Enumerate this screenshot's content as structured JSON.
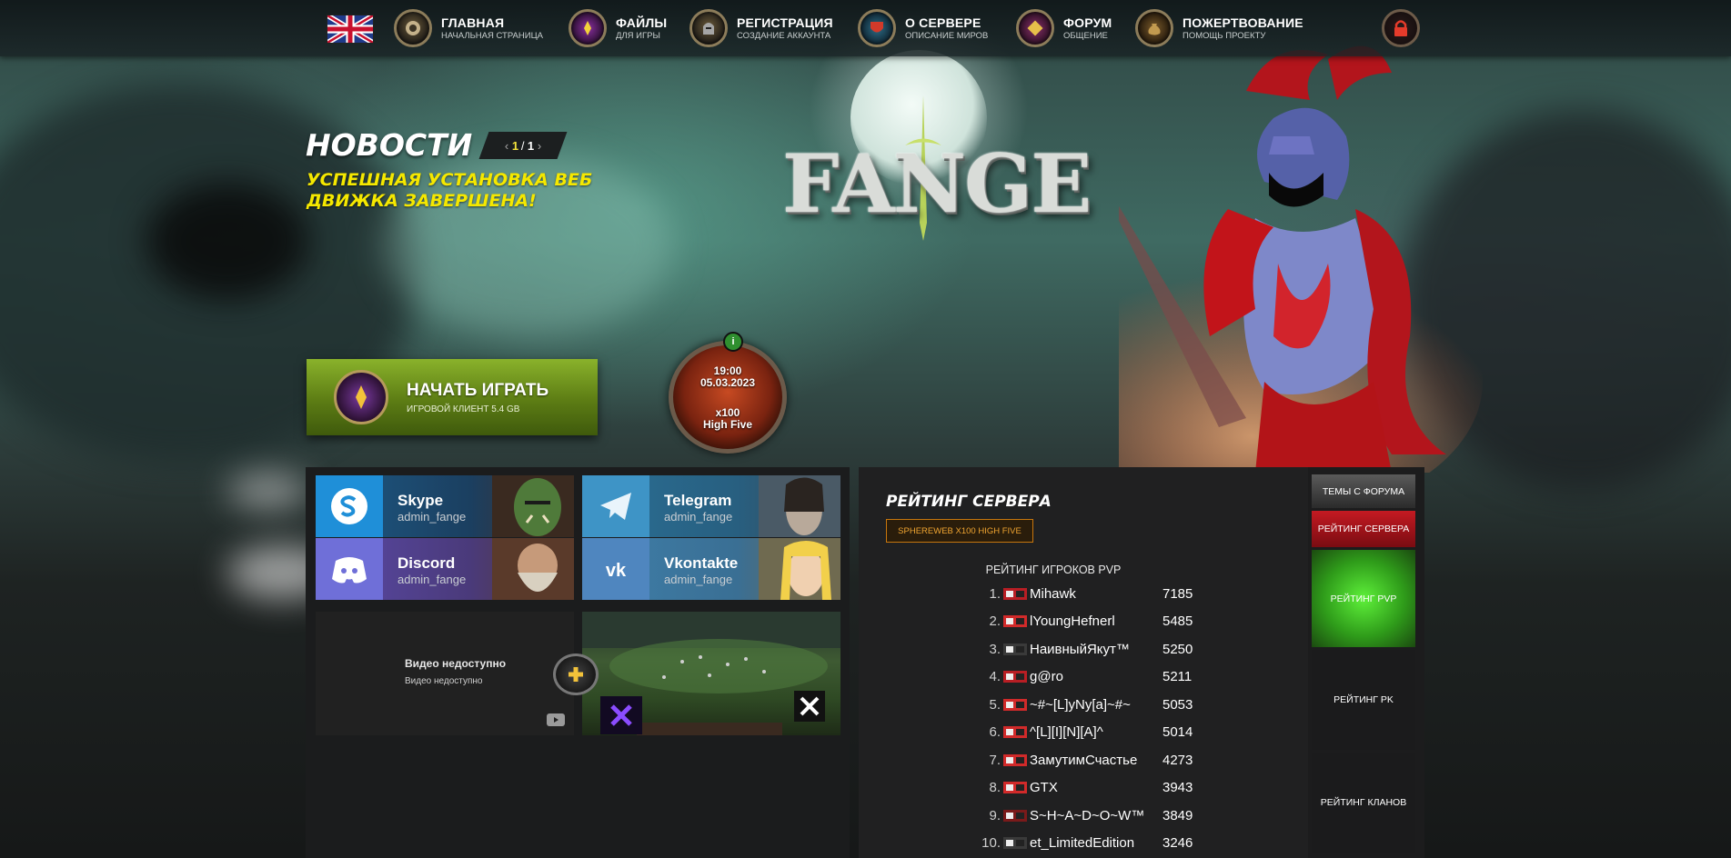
{
  "nav": {
    "items": [
      {
        "title": "ГЛАВНАЯ",
        "sub": "НАЧАЛЬНАЯ СТРАНИЦА"
      },
      {
        "title": "ФАЙЛЫ",
        "sub": "ДЛЯ ИГРЫ"
      },
      {
        "title": "РЕГИСТРАЦИЯ",
        "sub": "СОЗДАНИЕ АККАУНТА"
      },
      {
        "title": "О СЕРВЕРЕ",
        "sub": "ОПИСАНИЕ МИРОВ"
      },
      {
        "title": "ФОРУМ",
        "sub": "ОБЩЕНИЕ"
      },
      {
        "title": "ПОЖЕРТВОВАНИЕ",
        "sub": "ПОМОЩЬ ПРОЕКТУ"
      }
    ]
  },
  "news": {
    "title": "НОВОСТИ",
    "pager": {
      "current": "1",
      "sep": "/",
      "total": "1",
      "prev": "‹",
      "next": "›"
    },
    "headline": "УСПЕШНАЯ УСТАНОВКА ВЕБ ДВИЖКА ЗАВЕРШЕНА!"
  },
  "logo": {
    "text": "FANGE"
  },
  "play": {
    "title": "НАЧАТЬ ИГРАТЬ",
    "sub": "ИГРОВОЙ КЛИЕНТ 5.4 GB"
  },
  "server_badge": {
    "time": "19:00",
    "date": "05.03.2023",
    "rate": "x100",
    "chronicle": "High Five",
    "info": "i"
  },
  "social": [
    {
      "name": "Skype",
      "user": "admin_fange"
    },
    {
      "name": "Telegram",
      "user": "admin_fange"
    },
    {
      "name": "Discord",
      "user": "admin_fange"
    },
    {
      "name": "Vkontakte",
      "user": "admin_fange"
    }
  ],
  "video": {
    "unavailable_title": "Видео недоступно",
    "unavailable_sub": "Видео недоступно"
  },
  "rating": {
    "title": "РЕЙТИНГ СЕРВЕРА",
    "server_button": "SPHEREWEB X100 HIGH FIVE",
    "subtitle": "РЕЙТИНГ ИГРОКОВ PVP",
    "rows": [
      {
        "num": "1.",
        "name": "Mihawk",
        "score": "7185"
      },
      {
        "num": "2.",
        "name": "lYoungHefnerl",
        "score": "5485"
      },
      {
        "num": "3.",
        "name": "НаивныйЯкут™",
        "score": "5250"
      },
      {
        "num": "4.",
        "name": "g@ro",
        "score": "5211"
      },
      {
        "num": "5.",
        "name": "~#~[L]yNy[a]~#~",
        "score": "5053"
      },
      {
        "num": "6.",
        "name": "^[L][I][N][A]^",
        "score": "5014"
      },
      {
        "num": "7.",
        "name": "ЗамутимСчастье",
        "score": "4273"
      },
      {
        "num": "8.",
        "name": "GTX",
        "score": "3943"
      },
      {
        "num": "9.",
        "name": "S~H~A~D~O~W™",
        "score": "3849"
      },
      {
        "num": "10.",
        "name": "et_LimitedEdition",
        "score": "3246"
      }
    ],
    "tabs": [
      "ТЕМЫ С ФОРУМА",
      "РЕЙТИНГ СЕРВЕРА",
      "РЕЙТИНГ PVP",
      "РЕЙТИНГ PK",
      "РЕЙТИНГ КЛАНОВ"
    ]
  },
  "colors": {
    "accent_yellow": "#f5e800",
    "play_green": "#7ba428",
    "server_orange": "#f0a531",
    "tab_red": "#b3151c",
    "tab_green": "#4ed12e"
  }
}
